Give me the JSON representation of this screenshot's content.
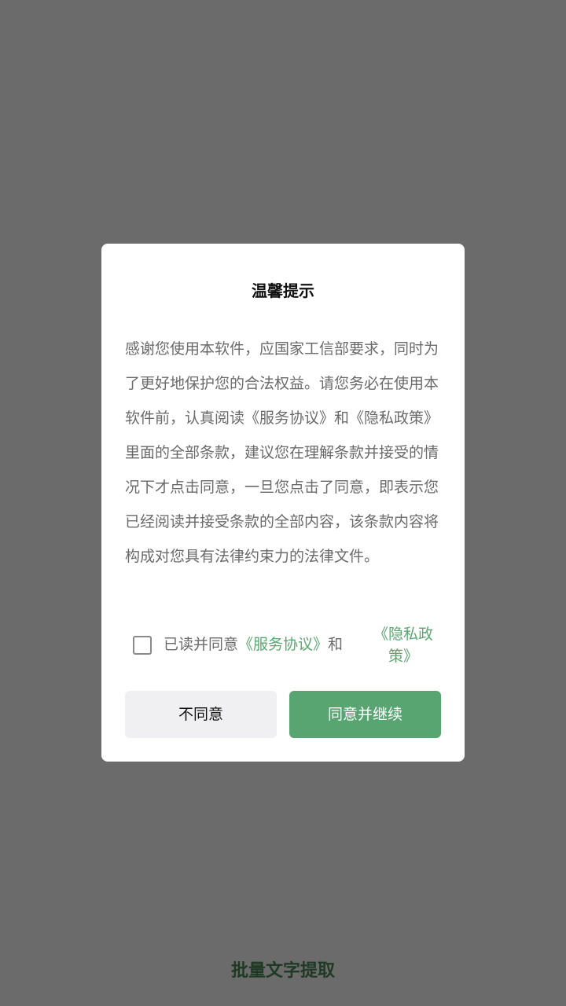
{
  "dialog": {
    "title": "温馨提示",
    "body": "感谢您使用本软件，应国家工信部要求，同时为了更好地保护您的合法权益。请您务必在使用本软件前，认真阅读《服务协议》和《隐私政策》里面的全部条款，建议您在理解条款并接受的情况下才点击同意，一旦您点击了同意，即表示您已经阅读并接受条款的全部内容，该条款内容将构成对您具有法律约束力的法律文件。",
    "agreement": {
      "prefix": "已读并同意",
      "service_link": "《服务协议》",
      "conjunction": "和",
      "privacy_link": "《隐私政策》",
      "checked": false
    },
    "buttons": {
      "disagree": "不同意",
      "agree": "同意并继续"
    }
  },
  "app_name": "批量文字提取",
  "colors": {
    "overlay": "#6b6b6b",
    "accent": "#58a572",
    "link": "#5aa76f",
    "app_name": "#1e3a24"
  }
}
